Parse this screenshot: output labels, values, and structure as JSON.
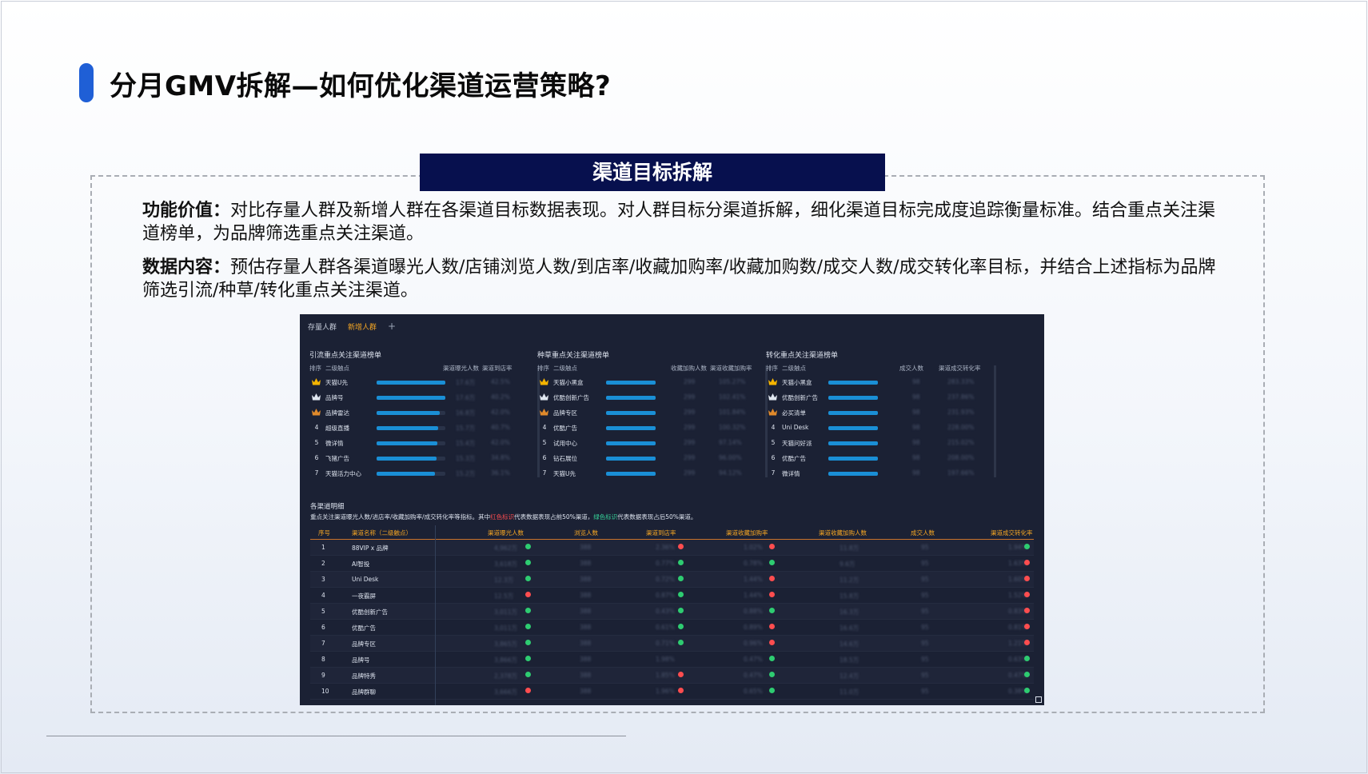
{
  "slide": {
    "title": "分月GMV拆解—如何优化渠道运营策略?",
    "section_label": "渠道目标拆解",
    "desc1_label": "功能价值：",
    "desc1_text": "对比存量人群及新增人群在各渠道目标数据表现。对人群目标分渠道拆解，细化渠道目标完成度追踪衡量标准。结合重点关注渠道榜单，为品牌筛选重点关注渠道。",
    "desc2_label": "数据内容：",
    "desc2_text": "预估存量人群各渠道曝光人数/店铺浏览人数/到店率/收藏加购率/收藏加购数/成交人数/成交转化率目标，并结合上述指标为品牌筛选引流/种草/转化重点关注渠道。"
  },
  "dashboard": {
    "tabs": [
      "存量人群",
      "新增人群"
    ],
    "active_tab": "新增人群",
    "add_tab": "+",
    "panels": [
      {
        "title": "引流重点关注渠道榜单",
        "headers": [
          "排序",
          "二级触点",
          "渠道曝光人数",
          "渠道到店率"
        ],
        "rows": [
          {
            "rank": "1",
            "crown": "gold",
            "name": "天猫U先",
            "fill": 1.0,
            "v1": "17.6万",
            "v2": "42.5%"
          },
          {
            "rank": "2",
            "crown": "silver",
            "name": "品牌号",
            "fill": 1.0,
            "v1": "17.6万",
            "v2": "40.2%"
          },
          {
            "rank": "3",
            "crown": "bronze",
            "name": "品牌雷达",
            "fill": 0.92,
            "v1": "16.8万",
            "v2": "42.0%"
          },
          {
            "rank": "4",
            "crown": "",
            "name": "超级直播",
            "fill": 0.9,
            "v1": "15.7万",
            "v2": "40.7%"
          },
          {
            "rank": "5",
            "crown": "",
            "name": "微详情",
            "fill": 0.88,
            "v1": "15.4万",
            "v2": "42.0%"
          },
          {
            "rank": "6",
            "crown": "",
            "name": "飞猪广告",
            "fill": 0.87,
            "v1": "15.3万",
            "v2": "34.8%"
          },
          {
            "rank": "7",
            "crown": "",
            "name": "天猫活力中心",
            "fill": 0.85,
            "v1": "15.2万",
            "v2": "36.1%"
          }
        ]
      },
      {
        "title": "种草重点关注渠道榜单",
        "headers": [
          "排序",
          "二级触点",
          "收藏加购人数",
          "渠道收藏加购率"
        ],
        "rows": [
          {
            "rank": "1",
            "crown": "gold",
            "name": "天猫小黑盒",
            "fill": 1.0,
            "v1": "299",
            "v2": "105.27%"
          },
          {
            "rank": "2",
            "crown": "silver",
            "name": "优酷创新广告",
            "fill": 1.0,
            "v1": "299",
            "v2": "102.41%"
          },
          {
            "rank": "3",
            "crown": "bronze",
            "name": "品牌专区",
            "fill": 1.0,
            "v1": "299",
            "v2": "101.84%"
          },
          {
            "rank": "4",
            "crown": "",
            "name": "优酷广告",
            "fill": 1.0,
            "v1": "299",
            "v2": "100.32%"
          },
          {
            "rank": "5",
            "crown": "",
            "name": "试用中心",
            "fill": 1.0,
            "v1": "299",
            "v2": "97.14%"
          },
          {
            "rank": "6",
            "crown": "",
            "name": "钻石展位",
            "fill": 1.0,
            "v1": "299",
            "v2": "96.00%"
          },
          {
            "rank": "7",
            "crown": "",
            "name": "天猫U先",
            "fill": 1.0,
            "v1": "299",
            "v2": "94.12%"
          }
        ]
      },
      {
        "title": "转化重点关注渠道榜单",
        "headers": [
          "排序",
          "二级触点",
          "成交人数",
          "渠道成交转化率"
        ],
        "rows": [
          {
            "rank": "1",
            "crown": "gold",
            "name": "天猫小黑盒",
            "fill": 1.0,
            "v1": "98",
            "v2": "283.33%"
          },
          {
            "rank": "2",
            "crown": "silver",
            "name": "优酷创新广告",
            "fill": 1.0,
            "v1": "98",
            "v2": "237.86%"
          },
          {
            "rank": "3",
            "crown": "bronze",
            "name": "必买清单",
            "fill": 1.0,
            "v1": "98",
            "v2": "231.93%"
          },
          {
            "rank": "4",
            "crown": "",
            "name": "Uni Desk",
            "fill": 1.0,
            "v1": "98",
            "v2": "228.00%"
          },
          {
            "rank": "5",
            "crown": "",
            "name": "天猫问好派",
            "fill": 1.0,
            "v1": "98",
            "v2": "215.02%"
          },
          {
            "rank": "6",
            "crown": "",
            "name": "优酷广告",
            "fill": 1.0,
            "v1": "98",
            "v2": "208.00%"
          },
          {
            "rank": "7",
            "crown": "",
            "name": "微详情",
            "fill": 1.0,
            "v1": "98",
            "v2": "197.66%"
          }
        ]
      }
    ],
    "detail": {
      "title": "各渠道明细",
      "note_prefix": "重点关注渠道曝光人数/进店率/收藏加购率/成交转化率等指标。其中",
      "note_red": "红色标识",
      "note_mid": "代表数据表现占前50%渠道，",
      "note_green": "绿色标识",
      "note_suffix": "代表数据表现占后50%渠道。",
      "headers": [
        "序号",
        "渠道名称（二级触点）",
        "渠道曝光人数",
        "浏览人数",
        "渠道到店率",
        "渠道收藏加购率",
        "渠道收藏加购人数",
        "成交人数",
        "渠道成交转化率"
      ],
      "rows": [
        {
          "no": "1",
          "name": "88VIP x 品牌",
          "c1": "4,962万",
          "d1": "g",
          "c2": "388",
          "c3": "2.36%",
          "d3": "r",
          "c4": "1.02%",
          "d4": "r",
          "c5": "11.8万",
          "c6": "95",
          "c7": "1.94%",
          "d7": "g"
        },
        {
          "no": "2",
          "name": "AI智投",
          "c1": "3,618万",
          "d1": "g",
          "c2": "388",
          "c3": "0.77%",
          "d3": "g",
          "c4": "0.78%",
          "d4": "g",
          "c5": "9.6万",
          "c6": "95",
          "c7": "1.63%",
          "d7": "r"
        },
        {
          "no": "3",
          "name": "Uni Desk",
          "c1": "12.3万",
          "d1": "g",
          "c2": "388",
          "c3": "0.72%",
          "d3": "g",
          "c4": "1.44%",
          "d4": "r",
          "c5": "11.2万",
          "c6": "95",
          "c7": "1.60%",
          "d7": "r"
        },
        {
          "no": "4",
          "name": "一夜霸屏",
          "c1": "12.5万",
          "d1": "r",
          "c2": "388",
          "c3": "0.87%",
          "d3": "g",
          "c4": "1.44%",
          "d4": "r",
          "c5": "15.8万",
          "c6": "95",
          "c7": "1.52%",
          "d7": "r"
        },
        {
          "no": "5",
          "name": "优酷创新广告",
          "c1": "3,011万",
          "d1": "g",
          "c2": "388",
          "c3": "0.43%",
          "d3": "g",
          "c4": "0.88%",
          "d4": "g",
          "c5": "16.3万",
          "c6": "95",
          "c7": "0.83%",
          "d7": "r"
        },
        {
          "no": "6",
          "name": "优酷广告",
          "c1": "3,011万",
          "d1": "g",
          "c2": "388",
          "c3": "0.61%",
          "d3": "g",
          "c4": "0.89%",
          "d4": "r",
          "c5": "16.6万",
          "c6": "95",
          "c7": "0.81%",
          "d7": "r"
        },
        {
          "no": "7",
          "name": "品牌专区",
          "c1": "3,865万",
          "d1": "g",
          "c2": "388",
          "c3": "0.71%",
          "d3": "g",
          "c4": "0.96%",
          "d4": "r",
          "c5": "14.6万",
          "c6": "95",
          "c7": "1.21%",
          "d7": "r"
        },
        {
          "no": "8",
          "name": "品牌号",
          "c1": "3,866万",
          "d1": "g",
          "c2": "388",
          "c3": "1.98%",
          "d3": "",
          "c4": "0.47%",
          "d4": "g",
          "c5": "18.5万",
          "c6": "95",
          "c7": "0.63%",
          "d7": "g"
        },
        {
          "no": "9",
          "name": "品牌特秀",
          "c1": "2,378万",
          "d1": "g",
          "c2": "388",
          "c3": "1.85%",
          "d3": "r",
          "c4": "0.47%",
          "d4": "g",
          "c5": "12.4万",
          "c6": "95",
          "c7": "0.47%",
          "d7": "g"
        },
        {
          "no": "10",
          "name": "品牌群聊",
          "c1": "3,666万",
          "d1": "r",
          "c2": "388",
          "c3": "1.96%",
          "d3": "r",
          "c4": "0.65%",
          "d4": "g",
          "c5": "11.0万",
          "c6": "95",
          "c7": "0.38%",
          "d7": "g"
        }
      ]
    }
  },
  "colors": {
    "accent_blue": "#1f5fd6",
    "banner_navy": "#07104e",
    "dash_bg": "#1b2134",
    "bar_blue": "#1a8fd6",
    "header_orange": "#f5a623",
    "dot_green": "#2ecc71",
    "dot_red": "#ff4d4f",
    "crown_gold": "#f5b400",
    "crown_silver": "#dfe6f0",
    "crown_bronze": "#e08a2b"
  }
}
